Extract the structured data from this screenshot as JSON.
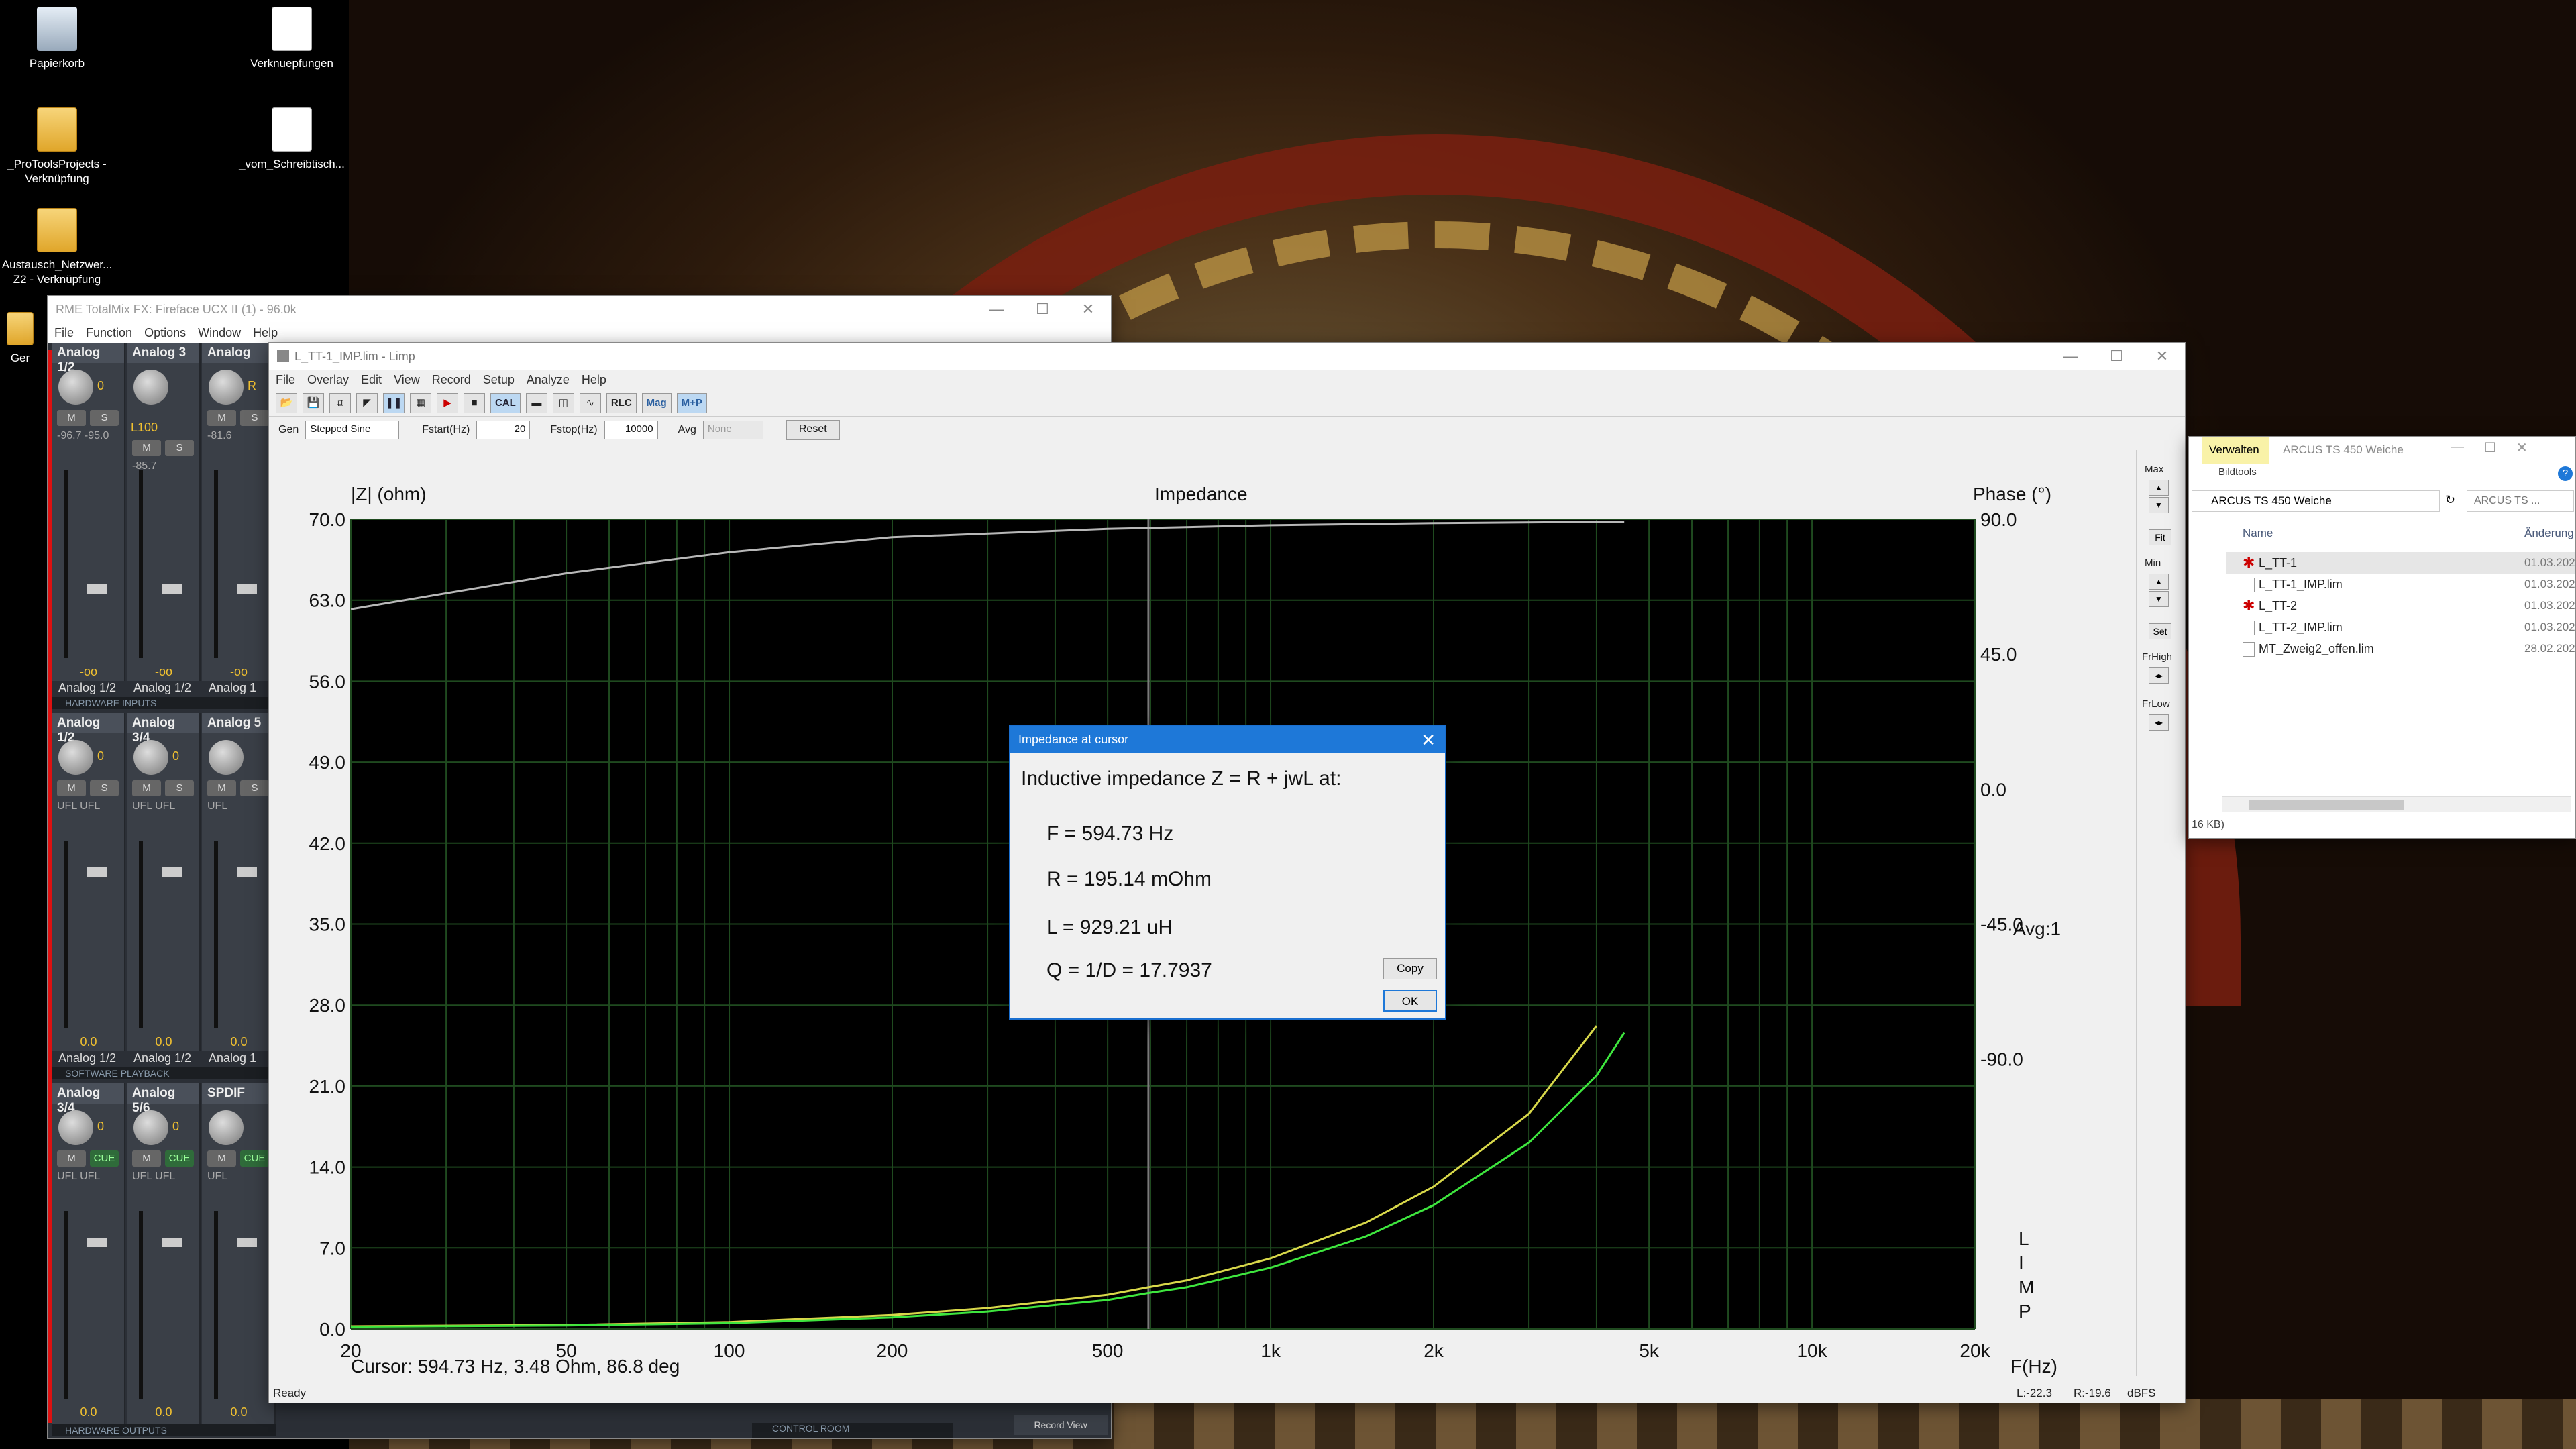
{
  "desktop": {
    "icons": [
      {
        "label": "Papierkorb",
        "type": "bin"
      },
      {
        "label": "Verknuepfungen",
        "type": "linkdoc"
      },
      {
        "label": "_ProToolsProjects - Verknüpfung",
        "type": "folder"
      },
      {
        "label": "_vom_Schreibtisch...",
        "type": "linkdoc"
      },
      {
        "label": "Austausch_Netzwer... Z2 - Verknüpfung",
        "type": "folder"
      },
      {
        "label": "Ger",
        "type": "folder"
      }
    ]
  },
  "totalmix": {
    "title": "RME TotalMix FX: Fireface UCX II (1) - 96.0k",
    "menu": [
      "File",
      "Function",
      "Options",
      "Window",
      "Help"
    ],
    "sections": [
      "HARDWARE INPUTS",
      "SOFTWARE PLAYBACK",
      "HARDWARE OUTPUTS"
    ],
    "rows": [
      {
        "channels": [
          {
            "name": "Analog 1/2",
            "knob": "0",
            "level": "-96.7 -95.0",
            "meter": "-oo",
            "foot": "Analog 1/2"
          },
          {
            "name": "Analog 3",
            "knob": "L100",
            "level": "-85.7",
            "meter": "-oo",
            "foot": "Analog 1/2"
          },
          {
            "name": "Analog",
            "knob": "R",
            "level": "-81.6",
            "meter": "-oo",
            "foot": "Analog 1"
          }
        ]
      },
      {
        "channels": [
          {
            "name": "Analog 1/2",
            "knob": "0",
            "level": "UFL UFL",
            "meter": "0.0",
            "foot": "Analog 1/2"
          },
          {
            "name": "Analog 3/4",
            "knob": "0",
            "level": "UFL UFL",
            "meter": "0.0",
            "foot": "Analog 1/2"
          },
          {
            "name": "Analog 5",
            "knob": "",
            "level": "UFL",
            "meter": "0.0",
            "foot": "Analog 1"
          }
        ]
      },
      {
        "channels": [
          {
            "name": "Analog 3/4",
            "knob": "0",
            "level": "UFL UFL",
            "meter": "0.0",
            "foot": ""
          },
          {
            "name": "Analog 5/6",
            "knob": "0",
            "level": "UFL UFL",
            "meter": "0.0",
            "foot": ""
          },
          {
            "name": "SPDIF",
            "knob": "",
            "level": "UFL",
            "meter": "0.0",
            "foot": ""
          }
        ]
      }
    ],
    "ms_labels": {
      "m": "M",
      "s": "S",
      "cue": "CUE"
    },
    "control_room": "CONTROL ROOM",
    "record_view": "Record View"
  },
  "limp": {
    "title": "L_TT-1_IMP.lim - Limp",
    "menu": [
      "File",
      "Overlay",
      "Edit",
      "View",
      "Record",
      "Setup",
      "Analyze",
      "Help"
    ],
    "toolbar": {
      "cal": "CAL",
      "rlc": "RLC",
      "mag": "Mag",
      "mp": "M+P"
    },
    "gen": {
      "label": "Gen",
      "value": "Stepped Sine"
    },
    "fstart": {
      "label": "Fstart(Hz)",
      "value": "20"
    },
    "fstop": {
      "label": "Fstop(Hz)",
      "value": "10000"
    },
    "avg": {
      "label": "Avg",
      "value": "None"
    },
    "reset_label": "Reset",
    "right_panel": {
      "max": "Max",
      "fit": "Fit",
      "min": "Min",
      "set": "Set",
      "frhigh": "FrHigh",
      "frlow": "FrLow"
    },
    "status": {
      "left": "Ready",
      "l": "L:-22.3",
      "r": "R:-19.6",
      "unit": "dBFS"
    }
  },
  "chart_data": {
    "type": "line",
    "title": "Impedance",
    "ylabel": "|Z| (ohm)",
    "y2label": "Phase (°)",
    "xlabel": "F(Hz)",
    "x_scale": "log",
    "xlim": [
      20,
      20000
    ],
    "ylim": [
      0,
      70
    ],
    "y2lim": [
      -180,
      90
    ],
    "x_ticks": [
      20,
      50,
      100,
      200,
      500,
      1000,
      2000,
      5000,
      10000,
      20000
    ],
    "x_tick_labels": [
      "20",
      "50",
      "100",
      "200",
      "500",
      "1k",
      "2k",
      "5k",
      "10k",
      "20k"
    ],
    "y_ticks": [
      "0.0",
      "7.0",
      "14.0",
      "21.0",
      "28.0",
      "35.0",
      "42.0",
      "49.0",
      "56.0",
      "63.0",
      "70.0"
    ],
    "y2_ticks": [
      "90.0",
      "45.0",
      "0.0",
      "-45.0",
      "-90.0"
    ],
    "avg_label": "Avg:1",
    "vertical_text": [
      "L",
      "I",
      "M",
      "P"
    ],
    "grid": true,
    "cursor_freq": 594.73,
    "cursor_text": "Cursor: 594.73 Hz, 3.48 Ohm, 86.8 deg",
    "colors": {
      "background": "#000000",
      "grid": "#1f4a1f",
      "phase": "#b8b8b8",
      "mag_a": "#d8d84a",
      "mag_b": "#3ee63e",
      "cursor": "#7a7a7a"
    },
    "series": [
      {
        "x": [
          20,
          50,
          100,
          200,
          300,
          500,
          594.73,
          700,
          1000,
          1500,
          2000,
          3000,
          4000
        ],
        "y": [
          0.23,
          0.35,
          0.6,
          1.2,
          1.8,
          2.95,
          3.6,
          4.2,
          6.1,
          9.2,
          12.3,
          18.6,
          26.2
        ]
      },
      {
        "x": [
          20,
          50,
          100,
          200,
          300,
          500,
          594.73,
          700,
          1000,
          1500,
          2000,
          3000,
          4000,
          4500
        ],
        "y": [
          0.2,
          0.3,
          0.5,
          1.0,
          1.5,
          2.5,
          3.1,
          3.6,
          5.3,
          8.0,
          10.7,
          16.1,
          21.9,
          25.6
        ]
      },
      {
        "axis": "phase",
        "x": [
          20,
          50,
          100,
          200,
          500,
          1000,
          2000,
          4500
        ],
        "y": [
          60,
          72,
          79,
          84,
          86.8,
          88,
          88.7,
          89.2
        ]
      }
    ]
  },
  "dialog": {
    "title": "Impedance at cursor",
    "heading": "Inductive impedance Z = R + jwL at:",
    "f": "F = 594.73 Hz",
    "r": "R = 195.14 mOhm",
    "l": "L = 929.21 uH",
    "q": "Q = 1/D =  17.7937",
    "copy_label": "Copy",
    "ok_label": "OK",
    "close": "✕"
  },
  "explorer": {
    "title": "ARCUS TS 450 Weiche",
    "tab_manage": "Verwalten",
    "tab_tools": "Bildtools",
    "address": "ARCUS TS 450 Weiche",
    "search_placeholder": "ARCUS TS ...",
    "col_name": "Name",
    "col_date": "Änderung",
    "files": [
      {
        "name": "L_TT-1",
        "date": "01.03.202",
        "star": true
      },
      {
        "name": "L_TT-1_IMP.lim",
        "date": "01.03.202",
        "star": false
      },
      {
        "name": "L_TT-2",
        "date": "01.03.202",
        "star": true
      },
      {
        "name": "L_TT-2_IMP.lim",
        "date": "01.03.202",
        "star": false
      },
      {
        "name": "MT_Zweig2_offen.lim",
        "date": "28.02.202",
        "star": false
      }
    ],
    "size_text": "16 KB)"
  }
}
